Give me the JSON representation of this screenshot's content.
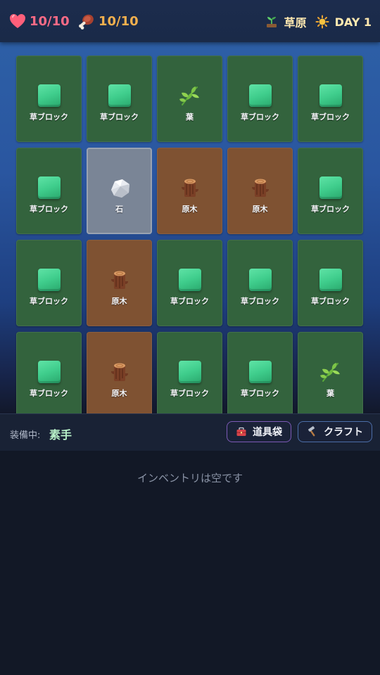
{
  "status": {
    "hp": "10/10",
    "food": "10/10",
    "biome": "草原",
    "day": "DAY 1"
  },
  "grid": {
    "rows": [
      [
        {
          "type": "grass",
          "label": "草ブロック"
        },
        {
          "type": "grass",
          "label": "草ブロック"
        },
        {
          "type": "leaf",
          "label": "葉"
        },
        {
          "type": "grass",
          "label": "草ブロック"
        },
        {
          "type": "grass",
          "label": "草ブロック"
        }
      ],
      [
        {
          "type": "grass",
          "label": "草ブロック"
        },
        {
          "type": "stone",
          "label": "石"
        },
        {
          "type": "log",
          "label": "原木"
        },
        {
          "type": "log",
          "label": "原木"
        },
        {
          "type": "grass",
          "label": "草ブロック"
        }
      ],
      [
        {
          "type": "grass",
          "label": "草ブロック"
        },
        {
          "type": "log",
          "label": "原木"
        },
        {
          "type": "grass",
          "label": "草ブロック"
        },
        {
          "type": "grass",
          "label": "草ブロック"
        },
        {
          "type": "grass",
          "label": "草ブロック"
        }
      ],
      [
        {
          "type": "grass",
          "label": "草ブロック"
        },
        {
          "type": "log",
          "label": "原木"
        },
        {
          "type": "grass",
          "label": "草ブロック"
        },
        {
          "type": "grass",
          "label": "草ブロック"
        },
        {
          "type": "leaf",
          "label": "葉"
        }
      ]
    ]
  },
  "equip": {
    "label": "装備中:",
    "value": "素手"
  },
  "buttons": {
    "bag": "道具袋",
    "craft": "クラフト"
  },
  "inventory": {
    "empty_text": "インベントリは空です"
  },
  "icons": {
    "hp": "heart-icon",
    "food": "meat-icon",
    "biome": "sprout-icon",
    "day": "sun-icon",
    "bag": "toolbox-icon",
    "craft": "hammer-icon"
  }
}
